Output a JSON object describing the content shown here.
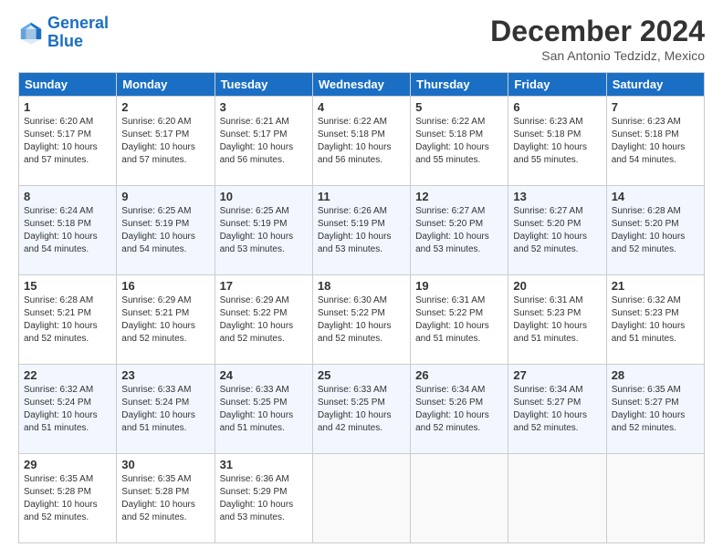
{
  "logo": {
    "line1": "General",
    "line2": "Blue"
  },
  "header": {
    "month": "December 2024",
    "location": "San Antonio Tedzidz, Mexico"
  },
  "days_of_week": [
    "Sunday",
    "Monday",
    "Tuesday",
    "Wednesday",
    "Thursday",
    "Friday",
    "Saturday"
  ],
  "weeks": [
    [
      {
        "day": "1",
        "info": "Sunrise: 6:20 AM\nSunset: 5:17 PM\nDaylight: 10 hours\nand 57 minutes."
      },
      {
        "day": "2",
        "info": "Sunrise: 6:20 AM\nSunset: 5:17 PM\nDaylight: 10 hours\nand 57 minutes."
      },
      {
        "day": "3",
        "info": "Sunrise: 6:21 AM\nSunset: 5:17 PM\nDaylight: 10 hours\nand 56 minutes."
      },
      {
        "day": "4",
        "info": "Sunrise: 6:22 AM\nSunset: 5:18 PM\nDaylight: 10 hours\nand 56 minutes."
      },
      {
        "day": "5",
        "info": "Sunrise: 6:22 AM\nSunset: 5:18 PM\nDaylight: 10 hours\nand 55 minutes."
      },
      {
        "day": "6",
        "info": "Sunrise: 6:23 AM\nSunset: 5:18 PM\nDaylight: 10 hours\nand 55 minutes."
      },
      {
        "day": "7",
        "info": "Sunrise: 6:23 AM\nSunset: 5:18 PM\nDaylight: 10 hours\nand 54 minutes."
      }
    ],
    [
      {
        "day": "8",
        "info": "Sunrise: 6:24 AM\nSunset: 5:18 PM\nDaylight: 10 hours\nand 54 minutes."
      },
      {
        "day": "9",
        "info": "Sunrise: 6:25 AM\nSunset: 5:19 PM\nDaylight: 10 hours\nand 54 minutes."
      },
      {
        "day": "10",
        "info": "Sunrise: 6:25 AM\nSunset: 5:19 PM\nDaylight: 10 hours\nand 53 minutes."
      },
      {
        "day": "11",
        "info": "Sunrise: 6:26 AM\nSunset: 5:19 PM\nDaylight: 10 hours\nand 53 minutes."
      },
      {
        "day": "12",
        "info": "Sunrise: 6:27 AM\nSunset: 5:20 PM\nDaylight: 10 hours\nand 53 minutes."
      },
      {
        "day": "13",
        "info": "Sunrise: 6:27 AM\nSunset: 5:20 PM\nDaylight: 10 hours\nand 52 minutes."
      },
      {
        "day": "14",
        "info": "Sunrise: 6:28 AM\nSunset: 5:20 PM\nDaylight: 10 hours\nand 52 minutes."
      }
    ],
    [
      {
        "day": "15",
        "info": "Sunrise: 6:28 AM\nSunset: 5:21 PM\nDaylight: 10 hours\nand 52 minutes."
      },
      {
        "day": "16",
        "info": "Sunrise: 6:29 AM\nSunset: 5:21 PM\nDaylight: 10 hours\nand 52 minutes."
      },
      {
        "day": "17",
        "info": "Sunrise: 6:29 AM\nSunset: 5:22 PM\nDaylight: 10 hours\nand 52 minutes."
      },
      {
        "day": "18",
        "info": "Sunrise: 6:30 AM\nSunset: 5:22 PM\nDaylight: 10 hours\nand 52 minutes."
      },
      {
        "day": "19",
        "info": "Sunrise: 6:31 AM\nSunset: 5:22 PM\nDaylight: 10 hours\nand 51 minutes."
      },
      {
        "day": "20",
        "info": "Sunrise: 6:31 AM\nSunset: 5:23 PM\nDaylight: 10 hours\nand 51 minutes."
      },
      {
        "day": "21",
        "info": "Sunrise: 6:32 AM\nSunset: 5:23 PM\nDaylight: 10 hours\nand 51 minutes."
      }
    ],
    [
      {
        "day": "22",
        "info": "Sunrise: 6:32 AM\nSunset: 5:24 PM\nDaylight: 10 hours\nand 51 minutes."
      },
      {
        "day": "23",
        "info": "Sunrise: 6:33 AM\nSunset: 5:24 PM\nDaylight: 10 hours\nand 51 minutes."
      },
      {
        "day": "24",
        "info": "Sunrise: 6:33 AM\nSunset: 5:25 PM\nDaylight: 10 hours\nand 51 minutes."
      },
      {
        "day": "25",
        "info": "Sunrise: 6:33 AM\nSunset: 5:25 PM\nDaylight: 10 hours\nand 42 minutes."
      },
      {
        "day": "26",
        "info": "Sunrise: 6:34 AM\nSunset: 5:26 PM\nDaylight: 10 hours\nand 52 minutes."
      },
      {
        "day": "27",
        "info": "Sunrise: 6:34 AM\nSunset: 5:27 PM\nDaylight: 10 hours\nand 52 minutes."
      },
      {
        "day": "28",
        "info": "Sunrise: 6:35 AM\nSunset: 5:27 PM\nDaylight: 10 hours\nand 52 minutes."
      }
    ],
    [
      {
        "day": "29",
        "info": "Sunrise: 6:35 AM\nSunset: 5:28 PM\nDaylight: 10 hours\nand 52 minutes."
      },
      {
        "day": "30",
        "info": "Sunrise: 6:35 AM\nSunset: 5:28 PM\nDaylight: 10 hours\nand 52 minutes."
      },
      {
        "day": "31",
        "info": "Sunrise: 6:36 AM\nSunset: 5:29 PM\nDaylight: 10 hours\nand 53 minutes."
      },
      {
        "day": "",
        "info": ""
      },
      {
        "day": "",
        "info": ""
      },
      {
        "day": "",
        "info": ""
      },
      {
        "day": "",
        "info": ""
      }
    ]
  ]
}
